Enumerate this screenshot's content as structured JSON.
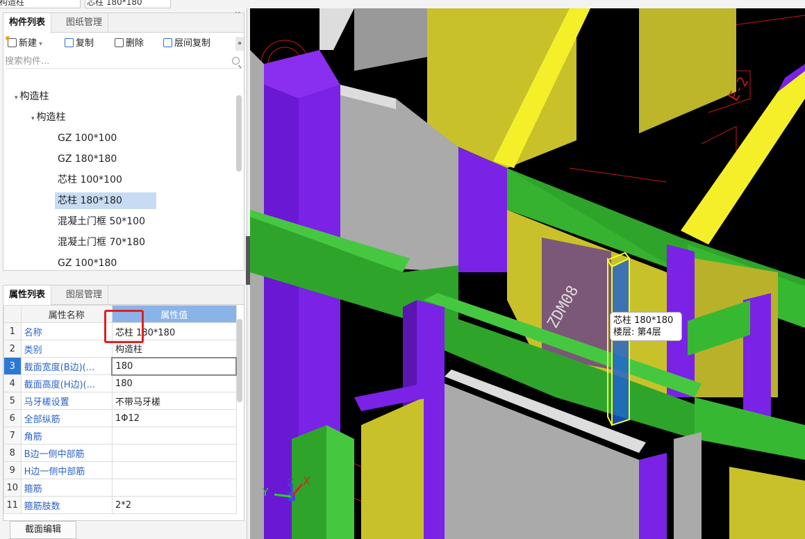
{
  "top": {
    "combo1": "构造柱",
    "combo2": "芯柱 180*180"
  },
  "component_panel": {
    "tabs": [
      "构件列表",
      "图纸管理"
    ],
    "toolbar": {
      "new": "新建",
      "copy": "复制",
      "delete": "删除",
      "floor_copy": "层间复制",
      "more": "»"
    },
    "search_placeholder": "搜索构件...",
    "tree": {
      "root": "构造柱",
      "group": "构造柱",
      "items": [
        "GZ 100*100",
        "GZ 180*180",
        "芯柱 100*100",
        "芯柱 180*180",
        "混凝土门框 50*100",
        "混凝土门框 70*180",
        "GZ 100*180"
      ],
      "selected_index": 3
    }
  },
  "property_panel": {
    "tabs": [
      "属性列表",
      "图层管理"
    ],
    "headers": {
      "name": "属性名称",
      "value": "属性值"
    },
    "rows": [
      {
        "idx": "1",
        "name": "名称",
        "value": "芯柱 180*180"
      },
      {
        "idx": "2",
        "name": "类别",
        "value": "构造柱"
      },
      {
        "idx": "3",
        "name": "截面宽度(B边)(...",
        "value": "180"
      },
      {
        "idx": "4",
        "name": "截面高度(H边)(...",
        "value": "180"
      },
      {
        "idx": "5",
        "name": "马牙槎设置",
        "value": "不带马牙槎"
      },
      {
        "idx": "6",
        "name": "全部纵筋",
        "value": "1Φ12"
      },
      {
        "idx": "7",
        "name": "角筋",
        "value": ""
      },
      {
        "idx": "8",
        "name": "B边一侧中部筋",
        "value": ""
      },
      {
        "idx": "9",
        "name": "H边一侧中部筋",
        "value": ""
      },
      {
        "idx": "10",
        "name": "箍筋",
        "value": ""
      },
      {
        "idx": "11",
        "name": "箍筋肢数",
        "value": "2*2"
      }
    ],
    "selected_row": "3",
    "section_edit_button": "截面编辑"
  },
  "viewport": {
    "tooltip_line1": "芯柱 180*180",
    "tooltip_line2": "楼层: 第4层",
    "cad_text_1": "ZDM08",
    "cad_text_2": "E-2",
    "axis_x": "X",
    "axis_y": "Y",
    "axis_z": "Z",
    "colors": {
      "background": "#000000",
      "wall_purple": "#7a22e6",
      "wall_yellow": "#c9c12a",
      "beam_green": "#37b832",
      "panel_gray": "#aaaaaa",
      "column_yellow": "#f5ef2a",
      "cad_red": "#c81818"
    }
  }
}
